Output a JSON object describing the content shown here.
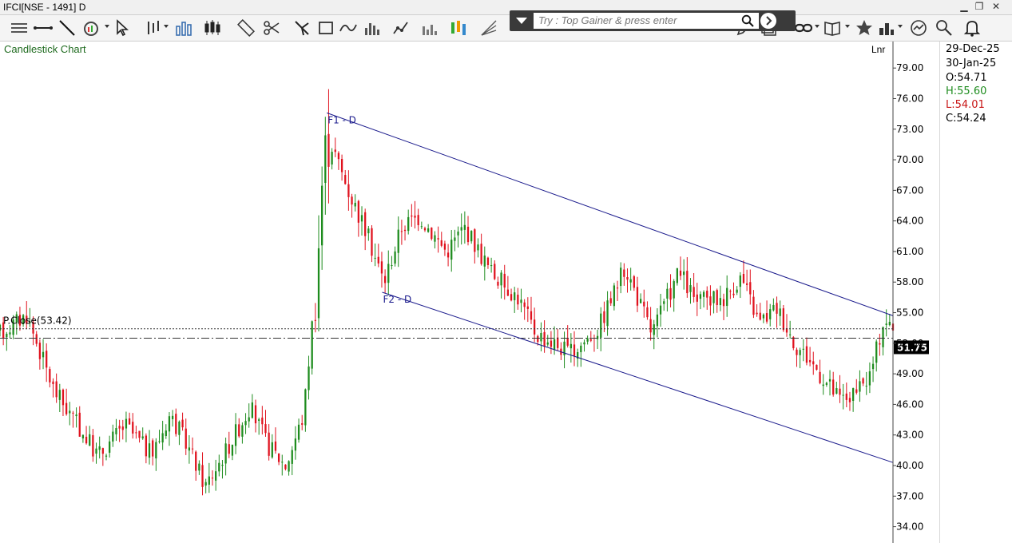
{
  "window": {
    "title": "IFCI[NSE - 1491] D"
  },
  "search": {
    "placeholder": "Try : Top Gainer & press enter"
  },
  "info_panel": {
    "date1": "29-Dec-25",
    "date2": "30-Jan-25",
    "open": "O:54.71",
    "high": "H:55.60",
    "low": "L:54.01",
    "close": "C:54.24"
  },
  "colors": {
    "up": "#1e8c1e",
    "down": "#e0121e",
    "trendline": "#1a1a8c",
    "high_text": "#1e8c1e",
    "low_text": "#c81414"
  },
  "chart_data": {
    "type": "candlestick",
    "title": "Candlestick Chart",
    "scale_label": "Lnr",
    "ylim": [
      32.4,
      81.6
    ],
    "y_ticks": [
      "79.00",
      "76.00",
      "73.00",
      "70.00",
      "67.00",
      "64.00",
      "61.00",
      "58.00",
      "55.00",
      "52.00",
      "49.00",
      "46.00",
      "43.00",
      "40.00",
      "37.00",
      "34.00"
    ],
    "prev_close": {
      "label": "P.Close(53.42)",
      "value": 53.42
    },
    "last_price": {
      "label": "51.75",
      "value": 52.5
    },
    "trendlines": [
      {
        "label": "F1 - D",
        "from": [
          0.366,
          74.6
        ],
        "to": [
          1.0,
          54.7
        ]
      },
      {
        "label": "F2 - D",
        "from": [
          0.428,
          57.0
        ],
        "to": [
          1.0,
          40.3
        ]
      }
    ],
    "anchors": [
      [
        0,
        53.0
      ],
      [
        0.03,
        54.8
      ],
      [
        0.06,
        47.5
      ],
      [
        0.09,
        43.5
      ],
      [
        0.11,
        41.0
      ],
      [
        0.14,
        44.0
      ],
      [
        0.17,
        41.0
      ],
      [
        0.19,
        45.0
      ],
      [
        0.21,
        42.0
      ],
      [
        0.23,
        38.0
      ],
      [
        0.25,
        41.0
      ],
      [
        0.28,
        45.8
      ],
      [
        0.3,
        42.0
      ],
      [
        0.32,
        40.0
      ],
      [
        0.34,
        45.0
      ],
      [
        0.355,
        59.0
      ],
      [
        0.362,
        70.0
      ],
      [
        0.368,
        72.3
      ],
      [
        0.39,
        67.0
      ],
      [
        0.41,
        63.0
      ],
      [
        0.43,
        58.0
      ],
      [
        0.45,
        63.5
      ],
      [
        0.47,
        64.5
      ],
      [
        0.5,
        61.0
      ],
      [
        0.52,
        63.5
      ],
      [
        0.55,
        59.0
      ],
      [
        0.58,
        56.5
      ],
      [
        0.6,
        53.0
      ],
      [
        0.64,
        51.0
      ],
      [
        0.67,
        53.5
      ],
      [
        0.7,
        59.5
      ],
      [
        0.73,
        53.0
      ],
      [
        0.76,
        59.0
      ],
      [
        0.78,
        56.0
      ],
      [
        0.81,
        56.5
      ],
      [
        0.83,
        58.5
      ],
      [
        0.85,
        54.0
      ],
      [
        0.87,
        55.5
      ],
      [
        0.89,
        52.0
      ],
      [
        0.91,
        50.0
      ],
      [
        0.94,
        46.5
      ],
      [
        0.96,
        47.0
      ],
      [
        0.975,
        49.0
      ],
      [
        0.99,
        54.5
      ],
      [
        1.0,
        53.2
      ]
    ]
  }
}
